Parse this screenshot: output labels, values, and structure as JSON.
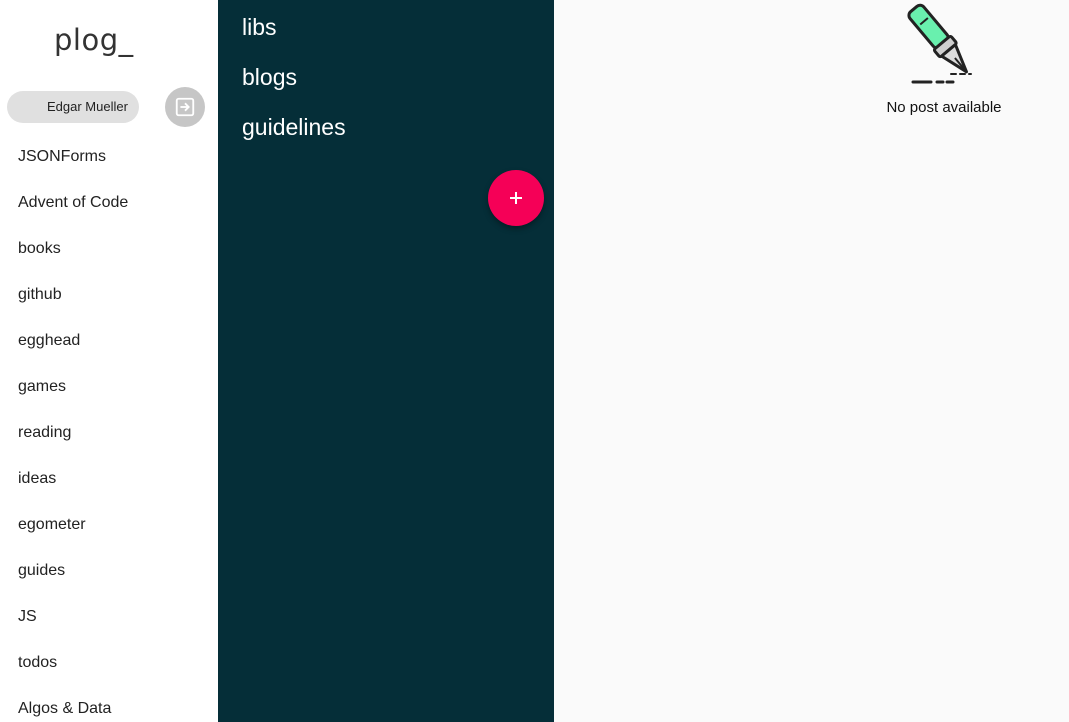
{
  "app": {
    "logo": "plog_"
  },
  "user": {
    "name": "Edgar Mueller"
  },
  "sidebar": {
    "items": [
      {
        "label": "JSONForms"
      },
      {
        "label": "Advent of Code"
      },
      {
        "label": "books"
      },
      {
        "label": "github"
      },
      {
        "label": "egghead"
      },
      {
        "label": "games"
      },
      {
        "label": "reading"
      },
      {
        "label": "ideas"
      },
      {
        "label": "egometer"
      },
      {
        "label": "guides"
      },
      {
        "label": "JS"
      },
      {
        "label": "todos"
      },
      {
        "label": "Algos & Data"
      }
    ]
  },
  "categories": {
    "items": [
      {
        "label": "libs"
      },
      {
        "label": "blogs"
      },
      {
        "label": "guidelines"
      }
    ]
  },
  "main": {
    "empty_message": "No post available"
  },
  "colors": {
    "middle_bg": "#052e38",
    "fab": "#f50057",
    "pen_accent": "#69f0ae"
  },
  "icons": {
    "logout": "logout-icon",
    "add": "plus-icon",
    "empty": "fountain-pen-icon"
  }
}
